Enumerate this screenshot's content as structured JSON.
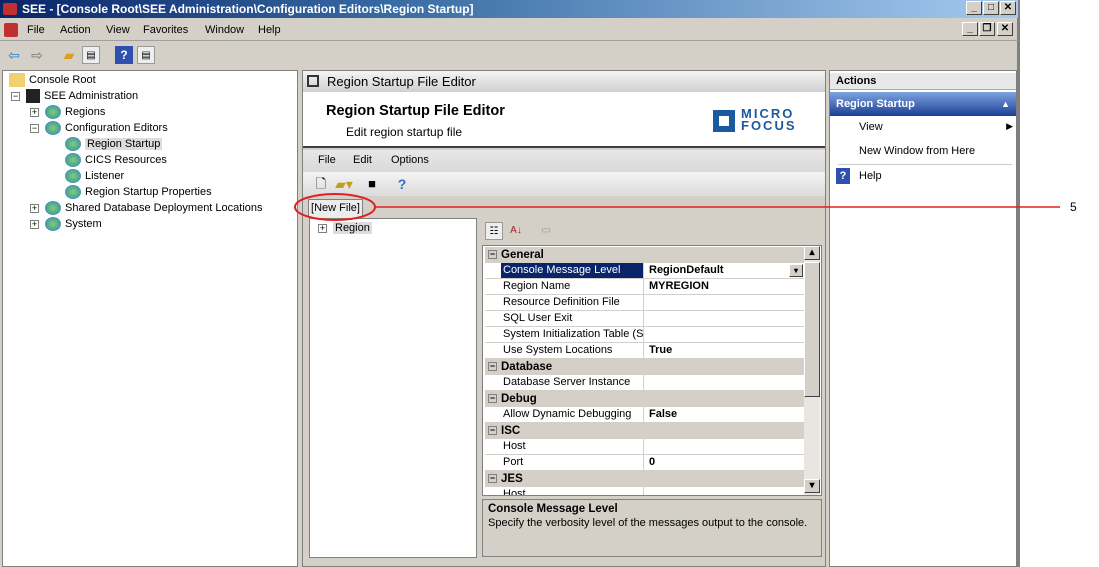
{
  "window": {
    "title": "SEE - [Console Root\\SEE Administration\\Configuration Editors\\Region Startup]"
  },
  "menu": [
    "File",
    "Action",
    "View",
    "Favorites",
    "Window",
    "Help"
  ],
  "toolbar_icons": [
    "back-arrow-icon",
    "forward-arrow-icon",
    "up-folder-icon",
    "show-hide-tree-icon",
    "help-icon",
    "show-hide-action-pane-icon"
  ],
  "tree": {
    "root": "Console Root",
    "items": [
      {
        "label": "SEE Administration",
        "level": 1,
        "expander": "−"
      },
      {
        "label": "Regions",
        "level": 2,
        "expander": "+"
      },
      {
        "label": "Configuration Editors",
        "level": 2,
        "expander": "−"
      },
      {
        "label": "Region Startup",
        "level": 3,
        "selected": true
      },
      {
        "label": "CICS Resources",
        "level": 3
      },
      {
        "label": "Listener",
        "level": 3
      },
      {
        "label": "Region Startup Properties",
        "level": 3
      },
      {
        "label": "Shared Database Deployment Locations",
        "level": 2,
        "expander": "+"
      },
      {
        "label": "System",
        "level": 2,
        "expander": "+"
      }
    ]
  },
  "editor": {
    "header": "Region Startup File Editor",
    "banner_title": "Region Startup File Editor",
    "banner_subtitle": "Edit region startup file",
    "logo": "MICRO FOCUS",
    "menu": [
      "File",
      "Edit",
      "Options"
    ],
    "tab": "[New File]",
    "tree_node": "Region",
    "properties": [
      {
        "group": "General",
        "rows": [
          {
            "name": "Console Message Level",
            "value": "RegionDefault",
            "selected": true
          },
          {
            "name": "Region Name",
            "value": "MYREGION"
          },
          {
            "name": "Resource Definition File",
            "value": ""
          },
          {
            "name": "SQL User Exit",
            "value": ""
          },
          {
            "name": "System Initialization Table (SIT)",
            "value": ""
          },
          {
            "name": "Use System Locations",
            "value": "True"
          }
        ]
      },
      {
        "group": "Database",
        "rows": [
          {
            "name": "Database Server Instance",
            "value": ""
          }
        ]
      },
      {
        "group": "Debug",
        "rows": [
          {
            "name": "Allow Dynamic Debugging",
            "value": "False"
          }
        ]
      },
      {
        "group": "ISC",
        "rows": [
          {
            "name": "Host",
            "value": ""
          },
          {
            "name": "Port",
            "value": "0"
          }
        ]
      },
      {
        "group": "JES",
        "rows": [
          {
            "name": "Host",
            "value": ""
          }
        ]
      }
    ],
    "description": {
      "title": "Console Message Level",
      "text": "Specify the verbosity level of the messages output to the console."
    }
  },
  "actions": {
    "header": "Actions",
    "section": "Region Startup",
    "items": [
      "View",
      "New Window from Here",
      "Help"
    ]
  },
  "annotation": {
    "label": "5",
    "color": "#e02020"
  },
  "colors": {
    "selection": "#0a246a",
    "actions_section": "#1c3f94"
  }
}
